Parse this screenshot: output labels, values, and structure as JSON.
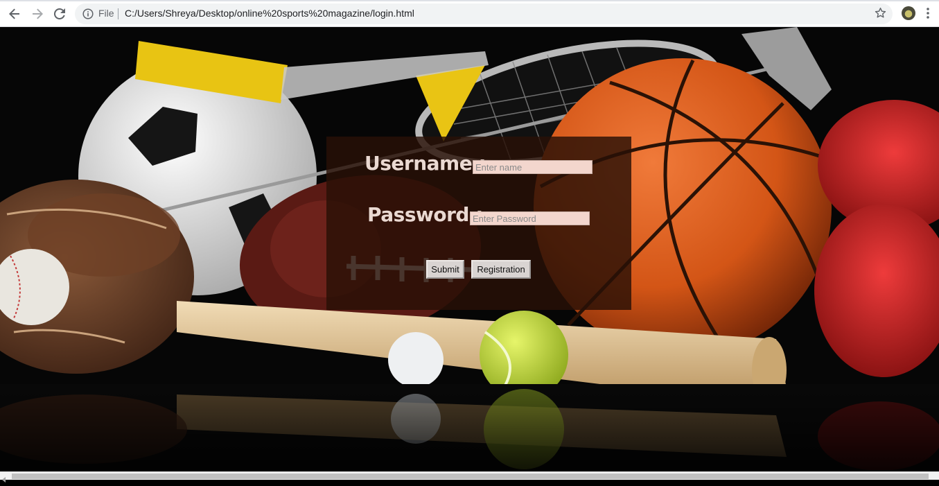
{
  "browser": {
    "file_chip": "File",
    "url": "C:/Users/Shreya/Desktop/online%20sports%20magazine/login.html",
    "icons": [
      "back-arrow-icon",
      "forward-arrow-icon",
      "reload-icon",
      "info-icon",
      "star-icon",
      "profile-avatar",
      "more-menu-icon"
    ]
  },
  "login": {
    "username_label": "Username :",
    "username_placeholder": "Enter name",
    "password_label": "Password :",
    "password_placeholder": "Enter Password",
    "submit_label": "Submit",
    "registration_label": "Registration"
  },
  "colors": {
    "panel_overlay": "#281006",
    "label_text": "#ead9d2",
    "input_bg": "#f3d6cd",
    "button_bg": "#d9d4d2"
  }
}
